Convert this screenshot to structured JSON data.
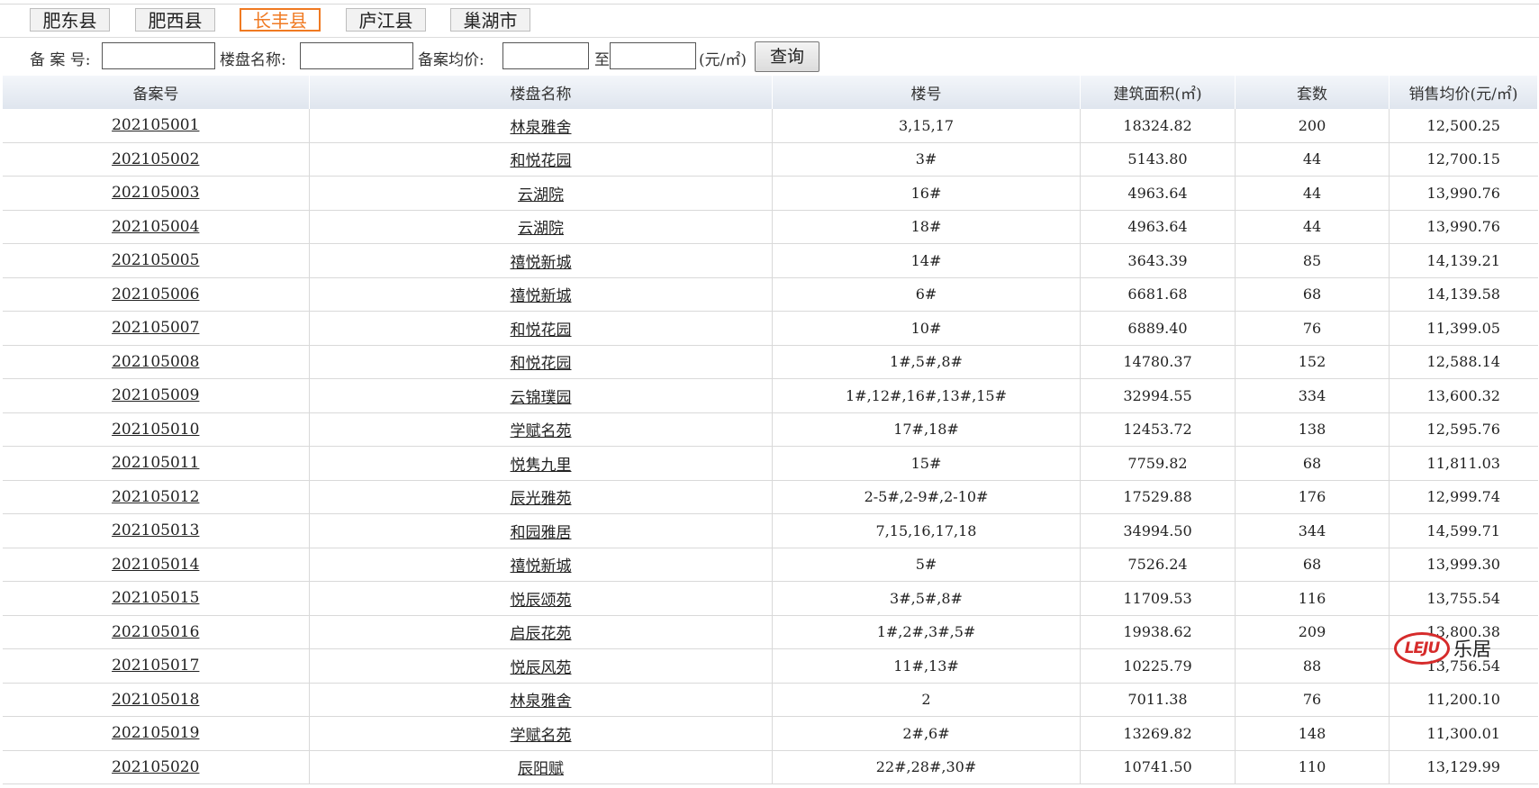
{
  "tabs": [
    {
      "label": "肥东县",
      "active": false
    },
    {
      "label": "肥西县",
      "active": false
    },
    {
      "label": "长丰县",
      "active": true
    },
    {
      "label": "庐江县",
      "active": false
    },
    {
      "label": "巢湖市",
      "active": false
    }
  ],
  "search": {
    "record_no_label": "备 案 号:",
    "project_name_label": "楼盘名称:",
    "avg_price_label": "备案均价:",
    "to_label": "至",
    "unit_label": "(元/㎡)",
    "query_button": "查询",
    "record_no_value": "",
    "project_name_value": "",
    "price_from_value": "",
    "price_to_value": ""
  },
  "table": {
    "headers": [
      "备案号",
      "楼盘名称",
      "楼号",
      "建筑面积(㎡)",
      "套数",
      "销售均价(元/㎡)"
    ],
    "rows": [
      [
        "202105001",
        "林泉雅舍",
        "3,15,17",
        "18324.82",
        "200",
        "12,500.25"
      ],
      [
        "202105002",
        "和悦花园",
        "3#",
        "5143.80",
        "44",
        "12,700.15"
      ],
      [
        "202105003",
        "云湖院",
        "16#",
        "4963.64",
        "44",
        "13,990.76"
      ],
      [
        "202105004",
        "云湖院",
        "18#",
        "4963.64",
        "44",
        "13,990.76"
      ],
      [
        "202105005",
        "禧悦新城",
        "14#",
        "3643.39",
        "85",
        "14,139.21"
      ],
      [
        "202105006",
        "禧悦新城",
        "6#",
        "6681.68",
        "68",
        "14,139.58"
      ],
      [
        "202105007",
        "和悦花园",
        "10#",
        "6889.40",
        "76",
        "11,399.05"
      ],
      [
        "202105008",
        "和悦花园",
        "1#,5#,8#",
        "14780.37",
        "152",
        "12,588.14"
      ],
      [
        "202105009",
        "云锦璞园",
        "1#,12#,16#,13#,15#",
        "32994.55",
        "334",
        "13,600.32"
      ],
      [
        "202105010",
        "学赋名苑",
        "17#,18#",
        "12453.72",
        "138",
        "12,595.76"
      ],
      [
        "202105011",
        "悦隽九里",
        "15#",
        "7759.82",
        "68",
        "11,811.03"
      ],
      [
        "202105012",
        "辰光雅苑",
        "2-5#,2-9#,2-10#",
        "17529.88",
        "176",
        "12,999.74"
      ],
      [
        "202105013",
        "和园雅居",
        "7,15,16,17,18",
        "34994.50",
        "344",
        "14,599.71"
      ],
      [
        "202105014",
        "禧悦新城",
        "5#",
        "7526.24",
        "68",
        "13,999.30"
      ],
      [
        "202105015",
        "悦辰颂苑",
        "3#,5#,8#",
        "11709.53",
        "116",
        "13,755.54"
      ],
      [
        "202105016",
        "启辰花苑",
        "1#,2#,3#,5#",
        "19938.62",
        "209",
        "13,800.38"
      ],
      [
        "202105017",
        "悦辰风苑",
        "11#,13#",
        "10225.79",
        "88",
        "13,756.54"
      ],
      [
        "202105018",
        "林泉雅舍",
        "2",
        "7011.38",
        "76",
        "11,200.10"
      ],
      [
        "202105019",
        "学赋名苑",
        "2#,6#",
        "13269.82",
        "148",
        "11,300.01"
      ],
      [
        "202105020",
        "辰阳赋",
        "22#,28#,30#",
        "10741.50",
        "110",
        "13,129.99"
      ]
    ]
  },
  "watermark": {
    "logo_text": "LEJU",
    "brand": "乐居"
  },
  "colors": {
    "active_tab": "#f07a22",
    "logo_red": "#d62b2b"
  }
}
